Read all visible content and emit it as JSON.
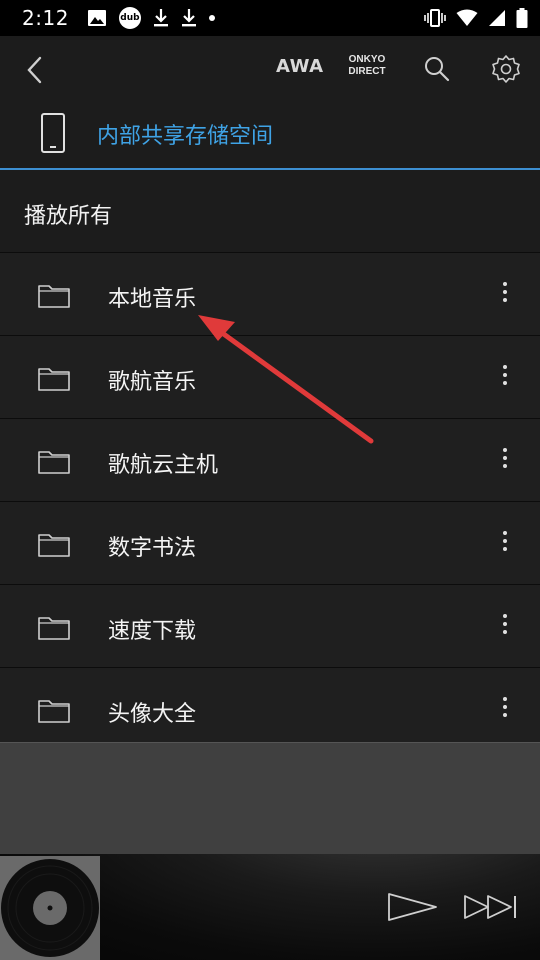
{
  "status_bar": {
    "time": "2:12",
    "dub_badge": "dub"
  },
  "toolbar": {
    "awa_label": "AWA",
    "onkyo_line1": "ONKYO",
    "onkyo_line2": "DIRECT"
  },
  "storage": {
    "title": "内部共享存储空间"
  },
  "play_all": {
    "label": "播放所有"
  },
  "folders": [
    {
      "label": "本地音乐"
    },
    {
      "label": "歌航音乐"
    },
    {
      "label": "歌航云主机"
    },
    {
      "label": "数字书法"
    },
    {
      "label": "速度下载"
    },
    {
      "label": "头像大全"
    }
  ],
  "colors": {
    "accent_blue": "#3fa3e6",
    "annotation_arrow": "#e03a3a"
  },
  "icons": {
    "back": "chevron-left-icon",
    "search": "search-icon",
    "settings": "gear-icon",
    "storage": "phone-icon",
    "folder": "folder-icon",
    "more": "more-vertical-icon",
    "play": "play-icon",
    "next": "skip-next-icon",
    "album": "vinyl-record-icon"
  }
}
